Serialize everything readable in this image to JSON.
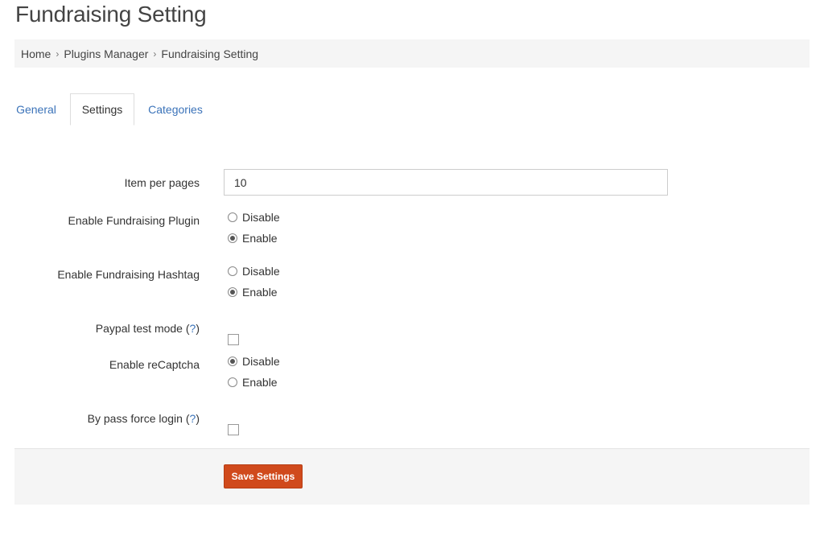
{
  "page": {
    "title": "Fundraising Setting"
  },
  "breadcrumb": {
    "items": [
      "Home",
      "Plugins Manager",
      "Fundraising Setting"
    ]
  },
  "tabs": [
    {
      "label": "General",
      "active": false
    },
    {
      "label": "Settings",
      "active": true
    },
    {
      "label": "Categories",
      "active": false
    }
  ],
  "form": {
    "item_per_pages": {
      "label": "Item per pages",
      "value": "10"
    },
    "enable_plugin": {
      "label": "Enable Fundraising Plugin",
      "options": [
        "Disable",
        "Enable"
      ],
      "selected": "Enable"
    },
    "enable_hashtag": {
      "label": "Enable Fundraising Hashtag",
      "options": [
        "Disable",
        "Enable"
      ],
      "selected": "Enable"
    },
    "paypal_test_mode": {
      "label": "Paypal test mode",
      "help": "?",
      "checked": false
    },
    "enable_recaptcha": {
      "label": "Enable reCaptcha",
      "options": [
        "Disable",
        "Enable"
      ],
      "selected": "Disable"
    },
    "bypass_force_login": {
      "label": "By pass force login",
      "help": "?",
      "checked": false
    }
  },
  "actions": {
    "save_label": "Save Settings"
  },
  "colors": {
    "accent": "#d04a1c",
    "link": "#3b73b9"
  }
}
